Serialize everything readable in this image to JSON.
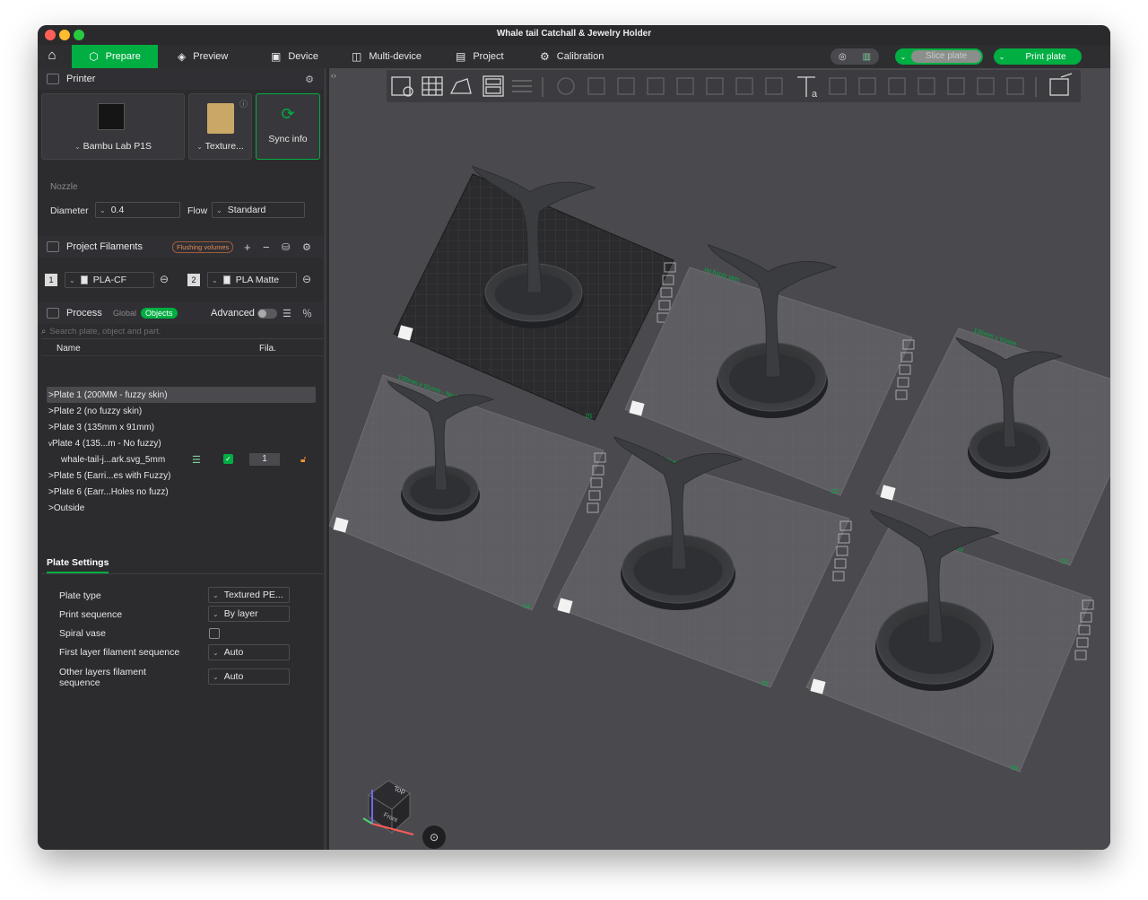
{
  "window": {
    "title": "Whale tail Catchall & Jewelry Holder"
  },
  "toolbar": {
    "tabs": [
      {
        "label": "Prepare",
        "icon": "cube-icon"
      },
      {
        "label": "Preview",
        "icon": "layers-icon"
      },
      {
        "label": "Device",
        "icon": "device-icon"
      },
      {
        "label": "Multi-device",
        "icon": "multi-device-icon"
      },
      {
        "label": "Project",
        "icon": "project-icon"
      },
      {
        "label": "Calibration",
        "icon": "calibration-icon"
      }
    ],
    "slice_label": "Slice plate",
    "print_label": "Print plate",
    "accent": "#00ae42"
  },
  "printer": {
    "section_title": "Printer",
    "model": "Bambu Lab P1S",
    "plate": "Texture...",
    "sync_label": "Sync info",
    "nozzle_label": "Nozzle",
    "diameter_label": "Diameter",
    "diameter_value": "0.4",
    "flow_label": "Flow",
    "flow_value": "Standard"
  },
  "filaments": {
    "section_title": "Project Filaments",
    "badge": "Flushing volumes",
    "items": [
      {
        "index": "1",
        "name": "PLA-CF",
        "color": "#2a2a2a"
      },
      {
        "index": "2",
        "name": "PLA Matte",
        "color": "#2a2a2a"
      }
    ]
  },
  "process": {
    "section_title": "Process",
    "scope_global": "Global",
    "scope_objects": "Objects",
    "advanced_label": "Advanced",
    "search_placeholder": "Search plate, object and part.",
    "col_name": "Name",
    "col_fila": "Fila."
  },
  "tree": [
    {
      "label": "Plate 1 (200MM - fuzzy skin)",
      "arrow": ">"
    },
    {
      "label": "Plate 2 (no fuzzy skin)",
      "arrow": ">"
    },
    {
      "label": "Plate 3 (135mm x 91mm)",
      "arrow": ">"
    },
    {
      "label": "Plate 4 (135...m - No fuzzy)",
      "arrow": "v"
    },
    {
      "label": "whale-tail-j...ark.svg_5mm",
      "arrow": "",
      "fila": "1"
    },
    {
      "label": "Plate 5 (Earri...es with Fuzzy)",
      "arrow": ">"
    },
    {
      "label": "Plate 6 (Earr...Holes no fuzz)",
      "arrow": ">"
    },
    {
      "label": "Outside",
      "arrow": ">"
    }
  ],
  "plate_settings": {
    "title": "Plate Settings",
    "rows": [
      {
        "label": "Plate type",
        "value": "Textured PE..."
      },
      {
        "label": "Print sequence",
        "value": "By layer"
      },
      {
        "label": "Spiral vase",
        "value": ""
      },
      {
        "label": "First layer filament sequence",
        "value": "Auto"
      },
      {
        "label": "Other layers filament sequence",
        "value": "Auto"
      }
    ]
  },
  "viewport": {
    "plate_badges": [
      "01",
      "02",
      "03",
      "04",
      "05",
      "06"
    ],
    "plate_labels": [
      "200MM - fuzzy skin",
      "no fuzzy skin",
      "135mm x 91mm",
      "135mm x 91mm - No fuzzy",
      "Earrings with Fuzzy",
      "Earrings Holes no fuzz"
    ],
    "bed_print": "Bambu Textured PEI Plate",
    "cube_top": "Top",
    "cube_front": "Front"
  }
}
